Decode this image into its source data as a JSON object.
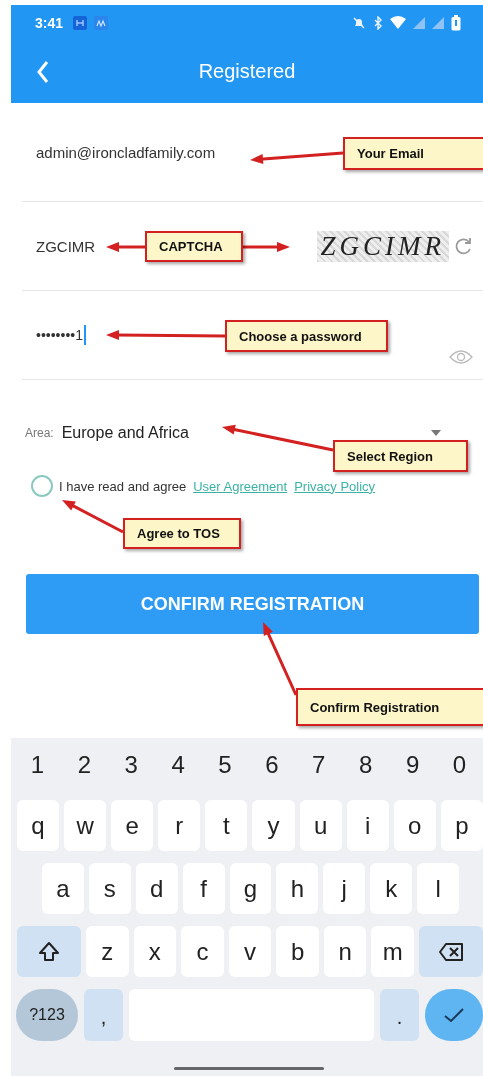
{
  "status_bar": {
    "time": "3:41"
  },
  "header": {
    "title": "Registered"
  },
  "email": {
    "value": "admin@ironcladfamily.com"
  },
  "captcha": {
    "value": "ZGCIMR",
    "image_text": "ZGCIMR"
  },
  "password": {
    "value": "••••••••1",
    "focused": true
  },
  "area": {
    "label": "Area:",
    "value": "Europe and Africa"
  },
  "agreement": {
    "checked": false,
    "text": "I have read and agree",
    "links": [
      "User Agreement",
      "Privacy Policy"
    ]
  },
  "confirm_button": {
    "label": "CONFIRM REGISTRATION"
  },
  "annotations": [
    {
      "text": "Your Email"
    },
    {
      "text": "CAPTCHA"
    },
    {
      "text": "Choose a password"
    },
    {
      "text": "Select Region"
    },
    {
      "text": "Agree to TOS"
    },
    {
      "text": "Confirm Registration"
    }
  ],
  "keyboard": {
    "number_row": [
      "1",
      "2",
      "3",
      "4",
      "5",
      "6",
      "7",
      "8",
      "9",
      "0"
    ],
    "rows": [
      [
        "q",
        "w",
        "e",
        "r",
        "t",
        "y",
        "u",
        "i",
        "o",
        "p"
      ],
      [
        "a",
        "s",
        "d",
        "f",
        "g",
        "h",
        "j",
        "k",
        "l"
      ],
      [
        "z",
        "x",
        "c",
        "v",
        "b",
        "n",
        "m"
      ]
    ],
    "bottom_row": [
      {
        "kind": "symbols",
        "label": "?123"
      },
      {
        "kind": "char",
        "label": ","
      },
      {
        "kind": "space"
      },
      {
        "kind": "char",
        "label": "."
      },
      {
        "kind": "enter"
      }
    ]
  }
}
